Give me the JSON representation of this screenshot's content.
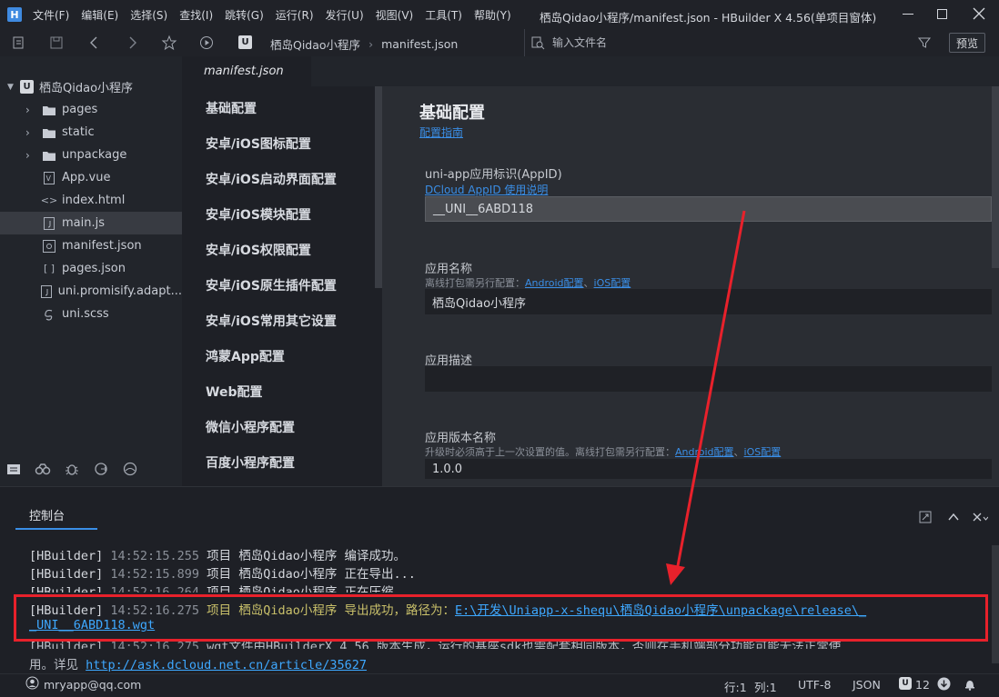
{
  "window": {
    "title": "栖岛Qidao小程序/manifest.json - HBuilder X 4.56(单项目窗体)",
    "menu": [
      "文件(F)",
      "编辑(E)",
      "选择(S)",
      "查找(I)",
      "跳转(G)",
      "运行(R)",
      "发行(U)",
      "视图(V)",
      "工具(T)",
      "帮助(Y)"
    ]
  },
  "toolbar": {
    "breadcrumb": [
      "栖岛Qidao小程序",
      "manifest.json"
    ],
    "file_search_placeholder": "输入文件名",
    "preview_label": "预览"
  },
  "sidebar": {
    "project": "栖岛Qidao小程序",
    "items": [
      {
        "label": "pages",
        "icon": "folder-icon",
        "kind": "folder"
      },
      {
        "label": "static",
        "icon": "folder-icon",
        "kind": "folder"
      },
      {
        "label": "unpackage",
        "icon": "folder-icon",
        "kind": "folder"
      },
      {
        "label": "App.vue",
        "icon": "vue-file-icon",
        "kind": "file"
      },
      {
        "label": "index.html",
        "icon": "html-file-icon",
        "kind": "file"
      },
      {
        "label": "main.js",
        "icon": "js-file-icon",
        "kind": "file",
        "active": true
      },
      {
        "label": "manifest.json",
        "icon": "manifest-file-icon",
        "kind": "file"
      },
      {
        "label": "pages.json",
        "icon": "json-file-icon",
        "kind": "file"
      },
      {
        "label": "uni.promisify.adapt...",
        "icon": "js-file-icon",
        "kind": "file"
      },
      {
        "label": "uni.scss",
        "icon": "scss-file-icon",
        "kind": "file"
      }
    ]
  },
  "editor": {
    "tab": "manifest.json",
    "nav": [
      "基础配置",
      "安卓/iOS图标配置",
      "安卓/iOS启动界面配置",
      "安卓/iOS模块配置",
      "安卓/iOS权限配置",
      "安卓/iOS原生插件配置",
      "安卓/iOS常用其它设置",
      "鸿蒙App配置",
      "Web配置",
      "微信小程序配置",
      "百度小程序配置"
    ],
    "form": {
      "heading": "基础配置",
      "guide_link": "配置指南",
      "appid_label": "uni-app应用标识(AppID)",
      "appid_link": "DCloud AppID 使用说明",
      "appid_value": "__UNI__6ABD118",
      "name_label": "应用名称",
      "name_hint": "离线打包需另行配置：",
      "name_hint_links": [
        "Android配置",
        "iOS配置"
      ],
      "name_value": "栖岛Qidao小程序",
      "desc_label": "应用描述",
      "desc_value": "",
      "version_label": "应用版本名称",
      "version_hint": "升级时必须高于上一次设置的值。离线打包需另行配置：",
      "version_hint_links": [
        "Android配置",
        "iOS配置"
      ],
      "version_value": "1.0.0"
    }
  },
  "console": {
    "tab": "控制台",
    "lines": [
      {
        "tag": "[HBuilder]",
        "time": "14:52:15.255",
        "text": "项目 栖岛Qidao小程序 编译成功。"
      },
      {
        "tag": "[HBuilder]",
        "time": "14:52:15.899",
        "text": "项目 栖岛Qidao小程序 正在导出..."
      },
      {
        "tag": "[HBuilder]",
        "time": "14:52:16.264",
        "text": "项目 栖岛Qidao小程序 正在压缩"
      },
      {
        "tag": "[HBuilder]",
        "time": "14:52:16.275",
        "text": "项目 栖岛Qidao小程序 导出成功，路径为：",
        "path": "E:\\开发\\Uniapp-x-shequ\\栖岛Qidao小程序\\unpackage\\release\\_",
        "path2": "_UNI__6ABD118.wgt"
      },
      {
        "tag": "[HBuilder]",
        "time": "14:52:16.275",
        "text": "wgt文件由HBuilderX 4.56 版本生成，运行的基座sdk也需配套相同版本，否则在手机端部分功能可能无法正常使",
        "text2": "用。详见 ",
        "link": "http://ask.dcloud.net.cn/article/35627"
      }
    ]
  },
  "status": {
    "user": "mryapp@qq.com",
    "line": "行:1",
    "col": "列:1",
    "encoding": "UTF-8",
    "lang": "JSON",
    "notify_count": "12"
  },
  "colors": {
    "accent": "#3a8ee6",
    "highlight": "#e8212b",
    "arrow": "#e8212b"
  }
}
